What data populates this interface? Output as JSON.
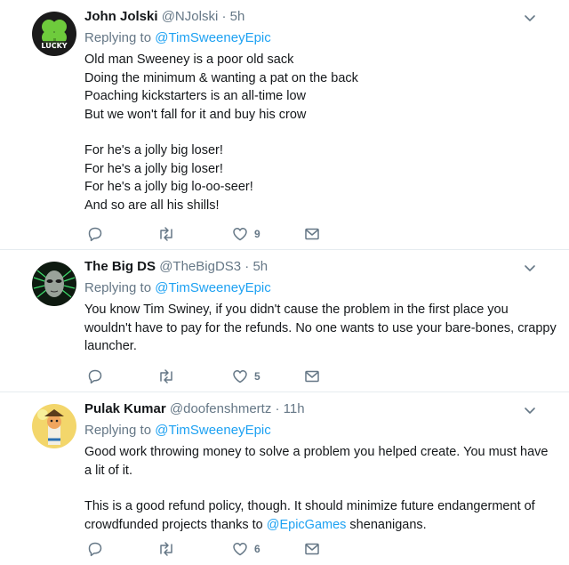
{
  "tweets": [
    {
      "name": "John Jolski",
      "handle": "@NJolski",
      "separator": "·",
      "time": "5h",
      "replying_prefix": "Replying to",
      "replying_to": "@TimSweeneyEpic",
      "avatar_text": "LUCKY",
      "lines": [
        "Old man Sweeney is a poor old sack",
        "Doing the minimum & wanting a pat on the back",
        "Poaching kickstarters is an all-time low",
        "But we won't fall for it and buy his crow"
      ],
      "lines2": [
        "For he's a jolly big loser!",
        "For he's a jolly big loser!",
        "For he's a jolly big lo-oo-seer!",
        "And so are all his shills!"
      ],
      "likes": "9",
      "icons": {
        "reply": "reply-icon",
        "retweet": "retweet-icon",
        "like": "heart-icon",
        "dm": "envelope-icon",
        "more": "chevron-down-icon"
      }
    },
    {
      "name": "The Big DS",
      "handle": "@TheBigDS3",
      "separator": "·",
      "time": "5h",
      "replying_prefix": "Replying to",
      "replying_to": "@TimSweeneyEpic",
      "text": "You know Tim Swiney, if you didn't cause the problem in the first place you wouldn't have to pay for the refunds. No one wants to use your bare-bones, crappy launcher.",
      "likes": "5"
    },
    {
      "name": "Pulak Kumar",
      "handle": "@doofenshmertz",
      "separator": "·",
      "time": "11h",
      "replying_prefix": "Replying to",
      "replying_to": "@TimSweeneyEpic",
      "para1": "Good work throwing money to solve a problem you helped create. You must have a lit of it.",
      "para2_before": "This is a good refund policy, though. It should minimize future endangerment of crowdfunded projects thanks to ",
      "para2_mention": "@EpicGames",
      "para2_after": " shenanigans.",
      "likes": "6"
    }
  ],
  "colors": {
    "accent": "#1da1f2",
    "muted": "#657786",
    "text": "#14171a",
    "divider": "#e6ecf0"
  }
}
